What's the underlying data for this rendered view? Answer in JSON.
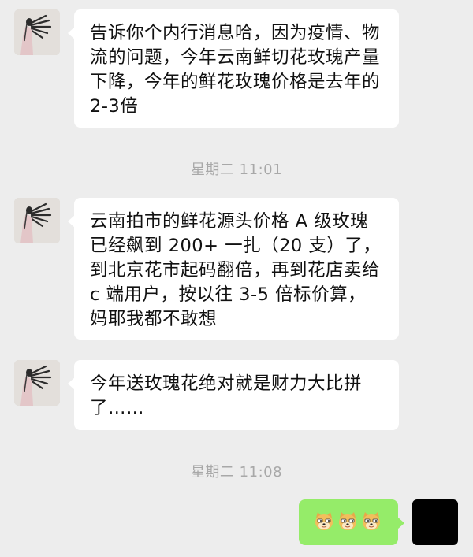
{
  "messages": [
    {
      "sender": "contact",
      "text": "告诉你个内行消息哈，因为疫情、物流的问题，今年云南鲜切花玫瑰产量下降，今年的鲜花玫瑰价格是去年的 2-3倍"
    },
    {
      "type": "timestamp",
      "text": "星期二 11:01"
    },
    {
      "sender": "contact",
      "text": "云南拍市的鲜花源头价格 A 级玫瑰已经飙到 200+ 一扎（20 支）了，到北京花市起码翻倍，再到花店卖给 c 端用户，按以往 3-5 倍标价算，妈耶我都不敢想"
    },
    {
      "sender": "contact",
      "text": "今年送玫瑰花绝对就是财力大比拼了……"
    },
    {
      "type": "timestamp",
      "text": "星期二 11:08"
    },
    {
      "sender": "me",
      "emoji": [
        "doge-emoji",
        "doge-emoji",
        "doge-emoji"
      ]
    }
  ],
  "colors": {
    "background": "#ededed",
    "incoming_bubble": "#ffffff",
    "outgoing_bubble": "#95ec69",
    "timestamp_text": "#a8a8a8"
  }
}
